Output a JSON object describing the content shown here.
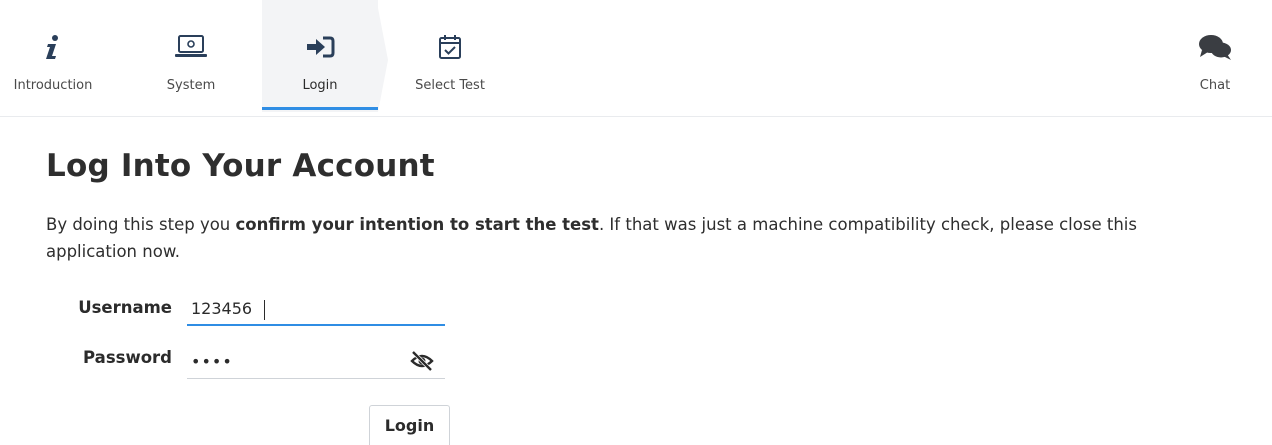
{
  "steps": [
    {
      "label": "Introduction",
      "icon": "info-icon"
    },
    {
      "label": "System",
      "icon": "laptop-icon"
    },
    {
      "label": "Login",
      "icon": "sign-in-icon"
    },
    {
      "label": "Select Test",
      "icon": "calendar-check-icon"
    }
  ],
  "active_step": "Login",
  "chat": {
    "label": "Chat",
    "icon": "chat-bubbles-icon"
  },
  "page": {
    "title": "Log Into Your Account",
    "intro_prefix": "By doing this step you ",
    "intro_bold": "confirm your intention to start the test",
    "intro_suffix": ". If that was just a machine compatibility check, please close this application now."
  },
  "form": {
    "username_label": "Username",
    "username_value": "123456",
    "password_label": "Password",
    "password_value": "••••",
    "password_toggle_icon": "eye-slash-icon",
    "login_label": "Login"
  },
  "colors": {
    "accent": "#2f8de4",
    "active_tab_bg": "#f3f4f6",
    "icon_dark": "#2a3f5a",
    "chat_icon": "#3a3d42"
  }
}
